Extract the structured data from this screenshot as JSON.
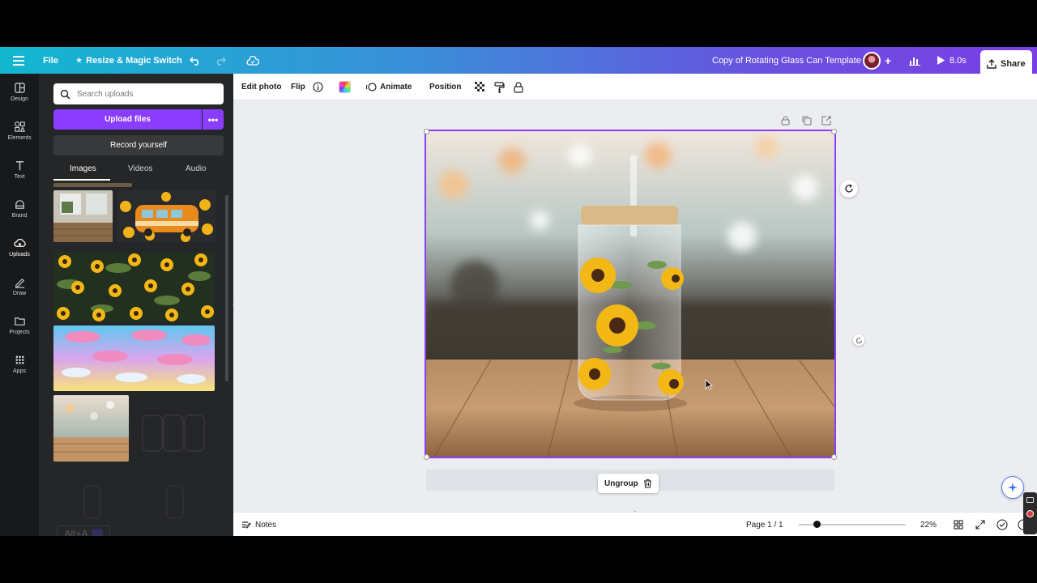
{
  "topbar": {
    "file_label": "File",
    "resize_label": "Resize & Magic Switch",
    "doc_title": "Copy of Rotating Glass Can Template",
    "duration_label": "8.0s",
    "share_label": "Share",
    "brand_color": "#8b3dff"
  },
  "rail": {
    "items": [
      {
        "label": "Design",
        "icon": "design-icon"
      },
      {
        "label": "Elements",
        "icon": "elements-icon"
      },
      {
        "label": "Text",
        "icon": "text-icon"
      },
      {
        "label": "Brand",
        "icon": "brand-icon"
      },
      {
        "label": "Uploads",
        "icon": "uploads-icon"
      },
      {
        "label": "Draw",
        "icon": "draw-icon"
      },
      {
        "label": "Projects",
        "icon": "projects-icon"
      },
      {
        "label": "Apps",
        "icon": "apps-icon"
      }
    ],
    "active": "Uploads"
  },
  "panel": {
    "search_placeholder": "Search uploads",
    "upload_label": "Upload files",
    "record_label": "Record yourself",
    "tabs": [
      "Images",
      "Videos",
      "Audio"
    ],
    "active_tab": "Images",
    "shortcut_hint": "Alt+A"
  },
  "toolbar": {
    "edit_photo": "Edit photo",
    "flip": "Flip",
    "animate": "Animate",
    "position": "Position"
  },
  "canvas": {
    "ungroup_label": "Ungroup"
  },
  "footer": {
    "notes_label": "Notes",
    "page_label": "Page 1 / 1",
    "zoom_label": "22%",
    "zoom_fraction": 0.17
  }
}
